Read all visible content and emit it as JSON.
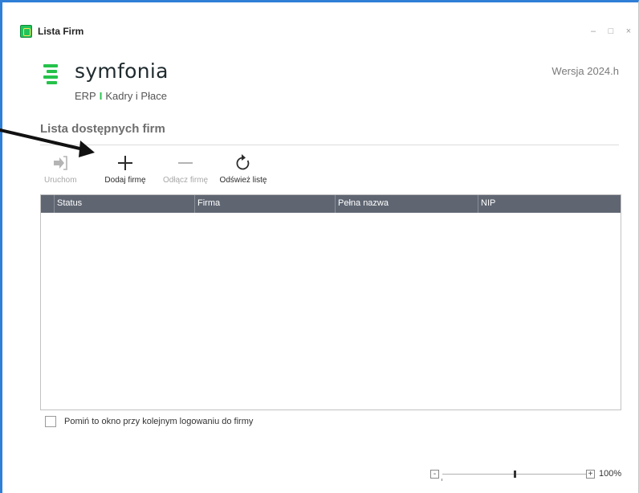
{
  "window": {
    "title": "Lista Firm",
    "controls": [
      "–",
      "□",
      "×"
    ]
  },
  "brand": {
    "name": "symfonia",
    "sub_left": "ERP",
    "separator": "I",
    "sub_right": "Kadry i Płace",
    "color": "#25c24a"
  },
  "version": "Wersja 2024.h",
  "section_title": "Lista dostępnych firm",
  "toolbar": {
    "run": {
      "label": "Uruchom",
      "icon": "run-icon",
      "enabled": false
    },
    "add": {
      "label": "Dodaj firmę",
      "icon": "plus-icon",
      "enabled": true
    },
    "detach": {
      "label": "Odłącz firmę",
      "icon": "minus-icon",
      "enabled": false
    },
    "refresh": {
      "label": "Odśwież listę",
      "icon": "refresh-icon",
      "enabled": true
    }
  },
  "table": {
    "columns": [
      "Status",
      "Firma",
      "Pełna nazwa",
      "NIP"
    ],
    "rows": []
  },
  "skip_checkbox": {
    "label": "Pomiń to okno przy kolejnym logowaniu do firmy",
    "checked": false
  },
  "zoom": {
    "minus": "-",
    "plus": "+",
    "value": "100%",
    "level": 0.5
  },
  "colors": {
    "accent": "#2f7fd6",
    "header_bg": "#5f6672"
  }
}
